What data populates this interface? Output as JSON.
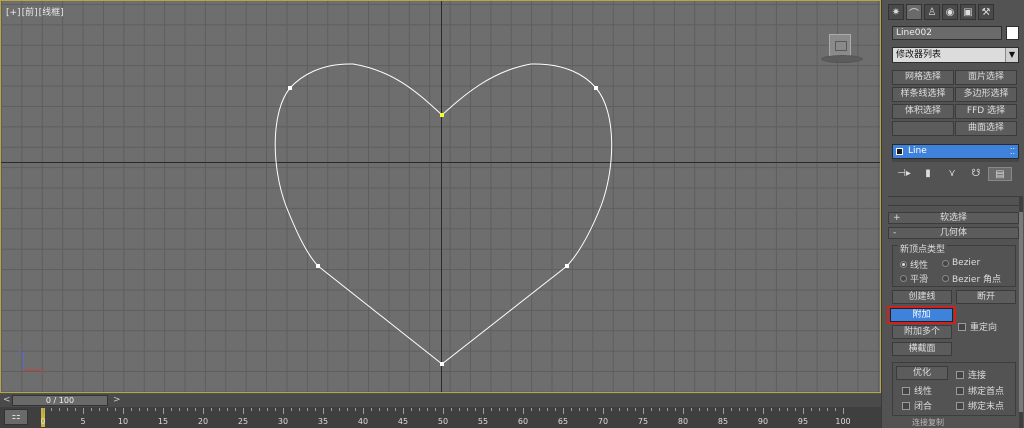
{
  "viewport": {
    "label_plus": "[+]",
    "label_view": "[前]",
    "label_mode": "[线框]"
  },
  "timeline": {
    "prev": "<",
    "slider_text": "0 / 100",
    "next": ">",
    "ticks": [
      "0",
      "5",
      "10",
      "15",
      "20",
      "25",
      "30",
      "35",
      "40",
      "45",
      "50",
      "55",
      "60",
      "65",
      "70",
      "75",
      "80",
      "85",
      "90",
      "95",
      "100"
    ]
  },
  "panel": {
    "tabs": [
      "create-icon",
      "modify-icon",
      "hierarchy-icon",
      "motion-icon",
      "display-icon",
      "utilities-icon"
    ],
    "object_name": "Line002",
    "modifier_list": "修改器列表",
    "modifier_buttons": [
      "网格选择",
      "面片选择",
      "样条线选择",
      "多边形选择",
      "体积选择",
      "FFD 选择",
      "",
      "曲面选择"
    ],
    "stack_item": "Line",
    "rollout_soft": "软选择",
    "rollout_soft_sign": "+",
    "rollout_geometry": "几何体",
    "rollout_geometry_sign": "-",
    "group_new_vertex": "新顶点类型",
    "radio_linear": "线性",
    "radio_bezier": "Bezier",
    "radio_smooth": "平滑",
    "radio_bezier_corner": "Bezier 角点",
    "btn_create_line": "创建线",
    "btn_break": "断开",
    "btn_attach": "附加",
    "chk_reorient": "重定向",
    "btn_attach_multi": "附加多个",
    "btn_cross_section": "横截面",
    "btn_refine": "优化",
    "chk_connect": "连接",
    "chk_linear": "线性",
    "chk_bind_first": "绑定首点",
    "chk_closed": "闭合",
    "chk_bind_last": "绑定末点",
    "cut_label": "连接复制"
  }
}
